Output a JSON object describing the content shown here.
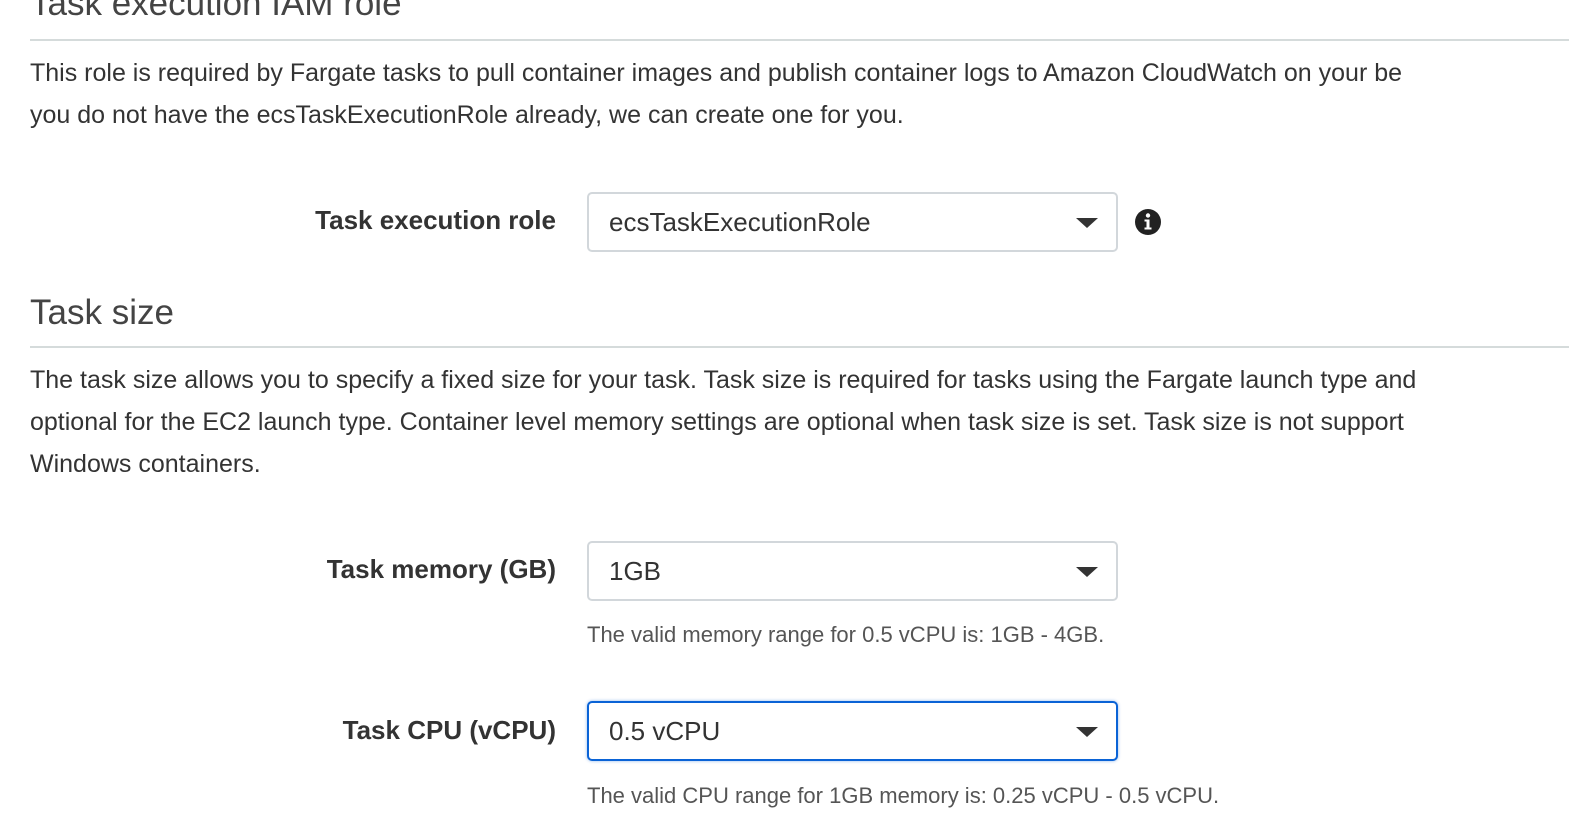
{
  "iam_section": {
    "title": "Task execution IAM role",
    "description_lines": [
      "This role is required by Fargate tasks to pull container images and publish container logs to Amazon CloudWatch on your be",
      "you do not have the ecsTaskExecutionRole already, we can create one for you."
    ],
    "execution_role": {
      "label": "Task execution role",
      "value": "ecsTaskExecutionRole",
      "info_icon": "info-icon"
    }
  },
  "task_size_section": {
    "title": "Task size",
    "description_lines": [
      "The task size allows you to specify a fixed size for your task. Task size is required for tasks using the Fargate launch type and",
      "optional for the EC2 launch type. Container level memory settings are optional when task size is set. Task size is not support",
      "Windows containers."
    ],
    "memory": {
      "label": "Task memory (GB)",
      "value": "1GB",
      "hint": "The valid memory range for 0.5 vCPU is: 1GB - 4GB."
    },
    "cpu": {
      "label": "Task CPU (vCPU)",
      "value": "0.5 vCPU",
      "hint": "The valid CPU range for 1GB memory is: 0.25 vCPU - 0.5 vCPU."
    }
  },
  "colors": {
    "focus_border": "#0a63d6",
    "divider": "#d5dbdb",
    "text": "#333333"
  }
}
